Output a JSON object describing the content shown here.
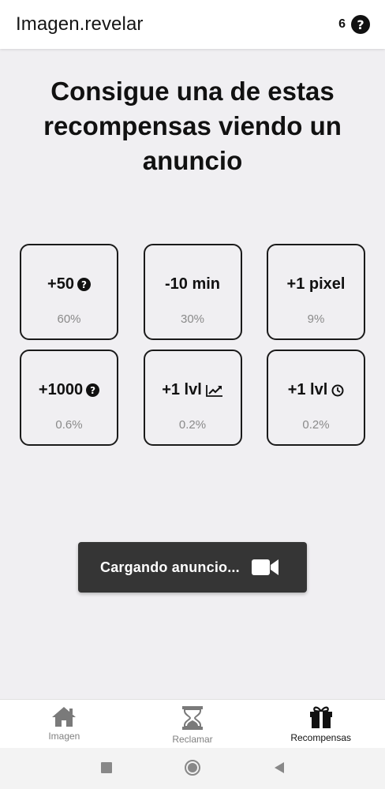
{
  "app_bar": {
    "title": "Imagen.revelar",
    "count": "6",
    "help_icon": "question-circle-icon"
  },
  "headline": "Consigue una de estas recompensas viendo un anuncio",
  "rewards": [
    {
      "label": "+50",
      "icon": "question-circle-icon",
      "probability": "60%"
    },
    {
      "label": "-10 min",
      "icon": "",
      "probability": "30%"
    },
    {
      "label": "+1 pixel",
      "icon": "",
      "probability": "9%"
    },
    {
      "label": "+1000",
      "icon": "question-circle-icon",
      "probability": "0.6%"
    },
    {
      "label": "+1 lvl",
      "icon": "trending-up-icon",
      "probability": "0.2%"
    },
    {
      "label": "+1 lvl",
      "icon": "clock-icon",
      "probability": "0.2%"
    }
  ],
  "toast": {
    "message": "Cargando anuncio...",
    "icon": "video-camera-icon"
  },
  "bottom_nav": {
    "items": [
      {
        "label": "Imagen",
        "icon": "home-icon",
        "active": false
      },
      {
        "label": "Reclamar",
        "icon": "hourglass-icon",
        "active": false
      },
      {
        "label": "Recompensas",
        "icon": "gift-icon",
        "active": true
      }
    ]
  },
  "system_nav": [
    "square-recents-icon",
    "circle-home-icon",
    "triangle-back-icon"
  ],
  "colors": {
    "background": "#f0eff2",
    "card_border": "#1a1a1a",
    "toast_bg": "#353535",
    "muted_text": "#8a8a8a",
    "inactive_nav": "#808080"
  }
}
